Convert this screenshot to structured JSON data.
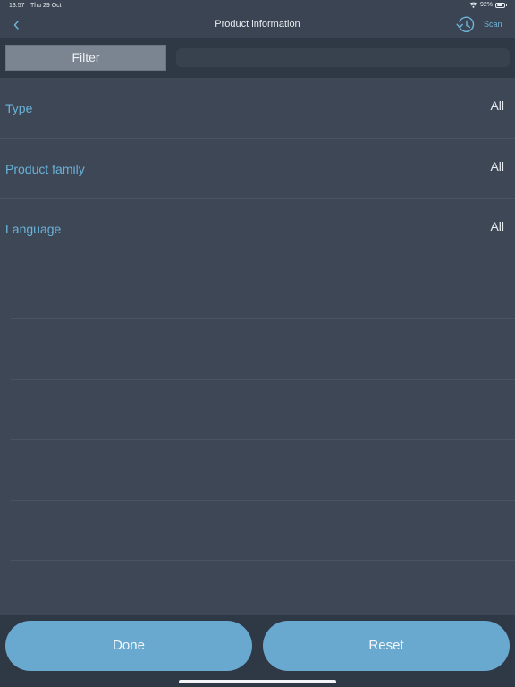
{
  "status_bar": {
    "time": "13:57",
    "date": "Thu 29 Oct",
    "battery_percent": "92%",
    "battery_level": 0.92
  },
  "nav": {
    "title": "Product information",
    "scan_label": "Scan",
    "back_icon": "chevron-left-icon",
    "history_icon": "history-clock-icon"
  },
  "filter": {
    "tab_label": "Filter",
    "field_value": ""
  },
  "filters": [
    {
      "label": "Type",
      "value": "All"
    },
    {
      "label": "Product family",
      "value": "All"
    },
    {
      "label": "Language",
      "value": "All"
    }
  ],
  "actions": {
    "done_label": "Done",
    "reset_label": "Reset"
  },
  "colors": {
    "accent": "#6aa9cf",
    "label": "#69b2d8",
    "background": "#3e4756",
    "bar": "#2f3845"
  }
}
